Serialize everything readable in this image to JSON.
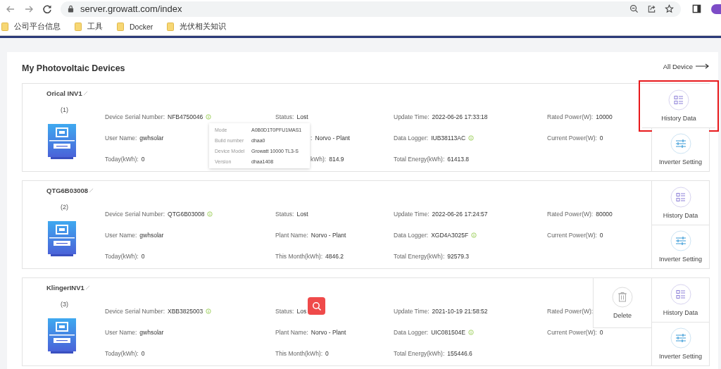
{
  "browser": {
    "url": "server.growatt.com/index",
    "bookmarks": [
      "公司平台信息",
      "工具",
      "Docker",
      "光伏相关知识"
    ]
  },
  "page": {
    "title": "My Photovoltaic Devices",
    "all_device_link": "All Device"
  },
  "devices": [
    {
      "name": "Orical INV1",
      "index": "(1)",
      "search_button": false,
      "fields": [
        {
          "kind": "full",
          "label": "Device Serial Number:",
          "value": "NFB4750046",
          "info": true
        },
        {
          "kind": "full",
          "label": "Status:",
          "value": "Lost",
          "info": false
        },
        {
          "kind": "full",
          "label": "Update Time:",
          "value": "2022-06-26 17:33:18",
          "info": false
        },
        {
          "kind": "full",
          "label": "Rated Power(W):",
          "value": "10000",
          "info": false
        },
        {
          "kind": "full",
          "label": "User Name:",
          "value": "gwhsolar",
          "info": false
        },
        {
          "kind": "partial",
          "label": ":",
          "value": "Norvo - Plant",
          "info": false
        },
        {
          "kind": "full",
          "label": "Data Logger:",
          "value": "IUB38113AC",
          "info": true
        },
        {
          "kind": "full",
          "label": "Current Power(W):",
          "value": "0",
          "info": false
        },
        {
          "kind": "full",
          "label": "Today(kWh):",
          "value": "0",
          "info": false
        },
        {
          "kind": "partial",
          "label": "kWh):",
          "value": "814.9",
          "info": false
        },
        {
          "kind": "full",
          "label": "Total Energy(kWh):",
          "value": "61413.8",
          "info": false
        }
      ],
      "actions": [
        {
          "kind": "history",
          "label": "History Data",
          "highlighted": true
        },
        {
          "kind": "settings",
          "label": "Inverter Setting",
          "highlighted": false
        }
      ],
      "tooltip": {
        "rows": [
          {
            "label": "Mode",
            "value": "A0B0D1T0PFU1MAS1"
          },
          {
            "label": "Build number",
            "value": "dhaa0"
          },
          {
            "label": "Device Model",
            "value": "Growatt 10000 TL3-S"
          },
          {
            "label": "Version",
            "value": "dhaa1408"
          }
        ]
      }
    },
    {
      "name": "QTG6B03008",
      "index": "(2)",
      "search_button": false,
      "fields": [
        {
          "kind": "full",
          "label": "Device Serial Number:",
          "value": "QTG6B03008",
          "info": true
        },
        {
          "kind": "full",
          "label": "Status:",
          "value": "Lost",
          "info": false
        },
        {
          "kind": "full",
          "label": "Update Time:",
          "value": "2022-06-26 17:24:57",
          "info": false
        },
        {
          "kind": "full",
          "label": "Rated Power(W):",
          "value": "80000",
          "info": false
        },
        {
          "kind": "full",
          "label": "User Name:",
          "value": "gwhsolar",
          "info": false
        },
        {
          "kind": "full",
          "label": "Plant Name:",
          "value": "Norvo - Plant",
          "info": false
        },
        {
          "kind": "full",
          "label": "Data Logger:",
          "value": "XGD4A3025F",
          "info": true
        },
        {
          "kind": "full",
          "label": "Current Power(W):",
          "value": "0",
          "info": false
        },
        {
          "kind": "full",
          "label": "Today(kWh):",
          "value": "0",
          "info": false
        },
        {
          "kind": "full",
          "label": "This Month(kWh):",
          "value": "4846.2",
          "info": false
        },
        {
          "kind": "full",
          "label": "Total Energy(kWh):",
          "value": "92579.3",
          "info": false
        }
      ],
      "actions": [
        {
          "kind": "history",
          "label": "History Data",
          "highlighted": false
        },
        {
          "kind": "settings",
          "label": "Inverter Setting",
          "highlighted": false
        }
      ]
    },
    {
      "name": "KlingerINV1",
      "index": "(3)",
      "search_button": true,
      "fields": [
        {
          "kind": "full",
          "label": "Device Serial Number:",
          "value": "XBB3825003",
          "info": true
        },
        {
          "kind": "full",
          "label": "Status:",
          "value": "Los",
          "info": false
        },
        {
          "kind": "full",
          "label": "Update Time:",
          "value": "2021-10-19 21:58:52",
          "info": false
        },
        {
          "kind": "full",
          "label": "Rated Power(W):",
          "info": false
        },
        {
          "kind": "full",
          "label": "User Name:",
          "value": "gwhsolar",
          "info": false
        },
        {
          "kind": "full",
          "label": "Plant Name:",
          "value": "Norvo - Plant",
          "info": false
        },
        {
          "kind": "full",
          "label": "Data Logger:",
          "value": "UIC081504E",
          "info": true
        },
        {
          "kind": "full",
          "label": "Current Power(W):",
          "value": "0",
          "info": false
        },
        {
          "kind": "full",
          "label": "Today(kWh):",
          "value": "0",
          "info": false
        },
        {
          "kind": "full",
          "label": "This Month(kWh):",
          "value": "0",
          "info": false
        },
        {
          "kind": "full",
          "label": "Total Energy(kWh):",
          "value": "155446.6",
          "info": false
        }
      ],
      "actions": [
        {
          "kind": "history",
          "label": "History Data",
          "highlighted": false
        },
        {
          "kind": "settings",
          "label": "Inverter Setting",
          "highlighted": false
        }
      ],
      "delete_action": {
        "label": "Delete"
      }
    }
  ]
}
